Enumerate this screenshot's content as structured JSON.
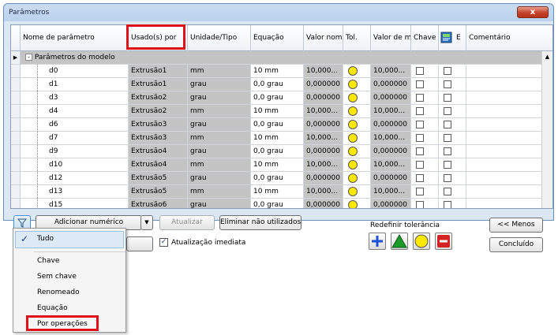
{
  "window": {
    "title": "Parâmetros",
    "close": "x"
  },
  "columns": [
    "Nome de parâmetro",
    "Usado(s) por",
    "Unidade/Tipo",
    "Equação",
    "Valor nomi",
    "Tol.",
    "Valor de m",
    "Chave",
    "E",
    "Comentário"
  ],
  "group_label": "Parâmetros do modelo",
  "rows": [
    {
      "name": "d0",
      "used_by": "Extrusão1",
      "unit": "mm",
      "equation": "10 mm",
      "nominal": "10,000...",
      "value": "10,000..."
    },
    {
      "name": "d1",
      "used_by": "Extrusão1",
      "unit": "grau",
      "equation": "0,0 grau",
      "nominal": "0,000000",
      "value": "0,000000"
    },
    {
      "name": "d3",
      "used_by": "Extrusão2",
      "unit": "grau",
      "equation": "0,0 grau",
      "nominal": "0,000000",
      "value": "0,000000"
    },
    {
      "name": "d4",
      "used_by": "Extrusão2",
      "unit": "mm",
      "equation": "10 mm",
      "nominal": "10,000...",
      "value": "10,000..."
    },
    {
      "name": "d6",
      "used_by": "Extrusão3",
      "unit": "grau",
      "equation": "0,0 grau",
      "nominal": "0,000000",
      "value": "0,000000"
    },
    {
      "name": "d7",
      "used_by": "Extrusão3",
      "unit": "mm",
      "equation": "10 mm",
      "nominal": "10,000...",
      "value": "10,000..."
    },
    {
      "name": "d9",
      "used_by": "Extrusão4",
      "unit": "grau",
      "equation": "0,0 grau",
      "nominal": "0,000000",
      "value": "0,000000"
    },
    {
      "name": "d10",
      "used_by": "Extrusão4",
      "unit": "mm",
      "equation": "10 mm",
      "nominal": "10,000...",
      "value": "10,000..."
    },
    {
      "name": "d12",
      "used_by": "Extrusão5",
      "unit": "grau",
      "equation": "0,0 grau",
      "nominal": "0,000000",
      "value": "0,000000"
    },
    {
      "name": "d13",
      "used_by": "Extrusão5",
      "unit": "mm",
      "equation": "10 mm",
      "nominal": "10,000...",
      "value": "10,000..."
    },
    {
      "name": "d15",
      "used_by": "Extrusão6",
      "unit": "grau",
      "equation": "0,0 grau",
      "nominal": "0,000000",
      "value": "0,000000"
    }
  ],
  "toolbar": {
    "add_numeric": "Adicionar numérico",
    "update": "Atualizar",
    "remove_unused": "Eliminar não utilizados",
    "immediate_update": "Atualização imediata",
    "reset_tolerance": "Redefinir tolerância",
    "less": "<< Menos",
    "done": "Concluído"
  },
  "filter_menu": {
    "items": [
      "Tudo",
      "Chave",
      "Sem chave",
      "Renomeado",
      "Equação",
      "Por operações"
    ],
    "checked": "Tudo"
  },
  "colors": {
    "highlight": "#e0101b",
    "tol_yellow": "#ffe800",
    "tol_green": "#1b9a2a",
    "tol_blue": "#1e4fd7",
    "tol_red": "#d42323"
  }
}
